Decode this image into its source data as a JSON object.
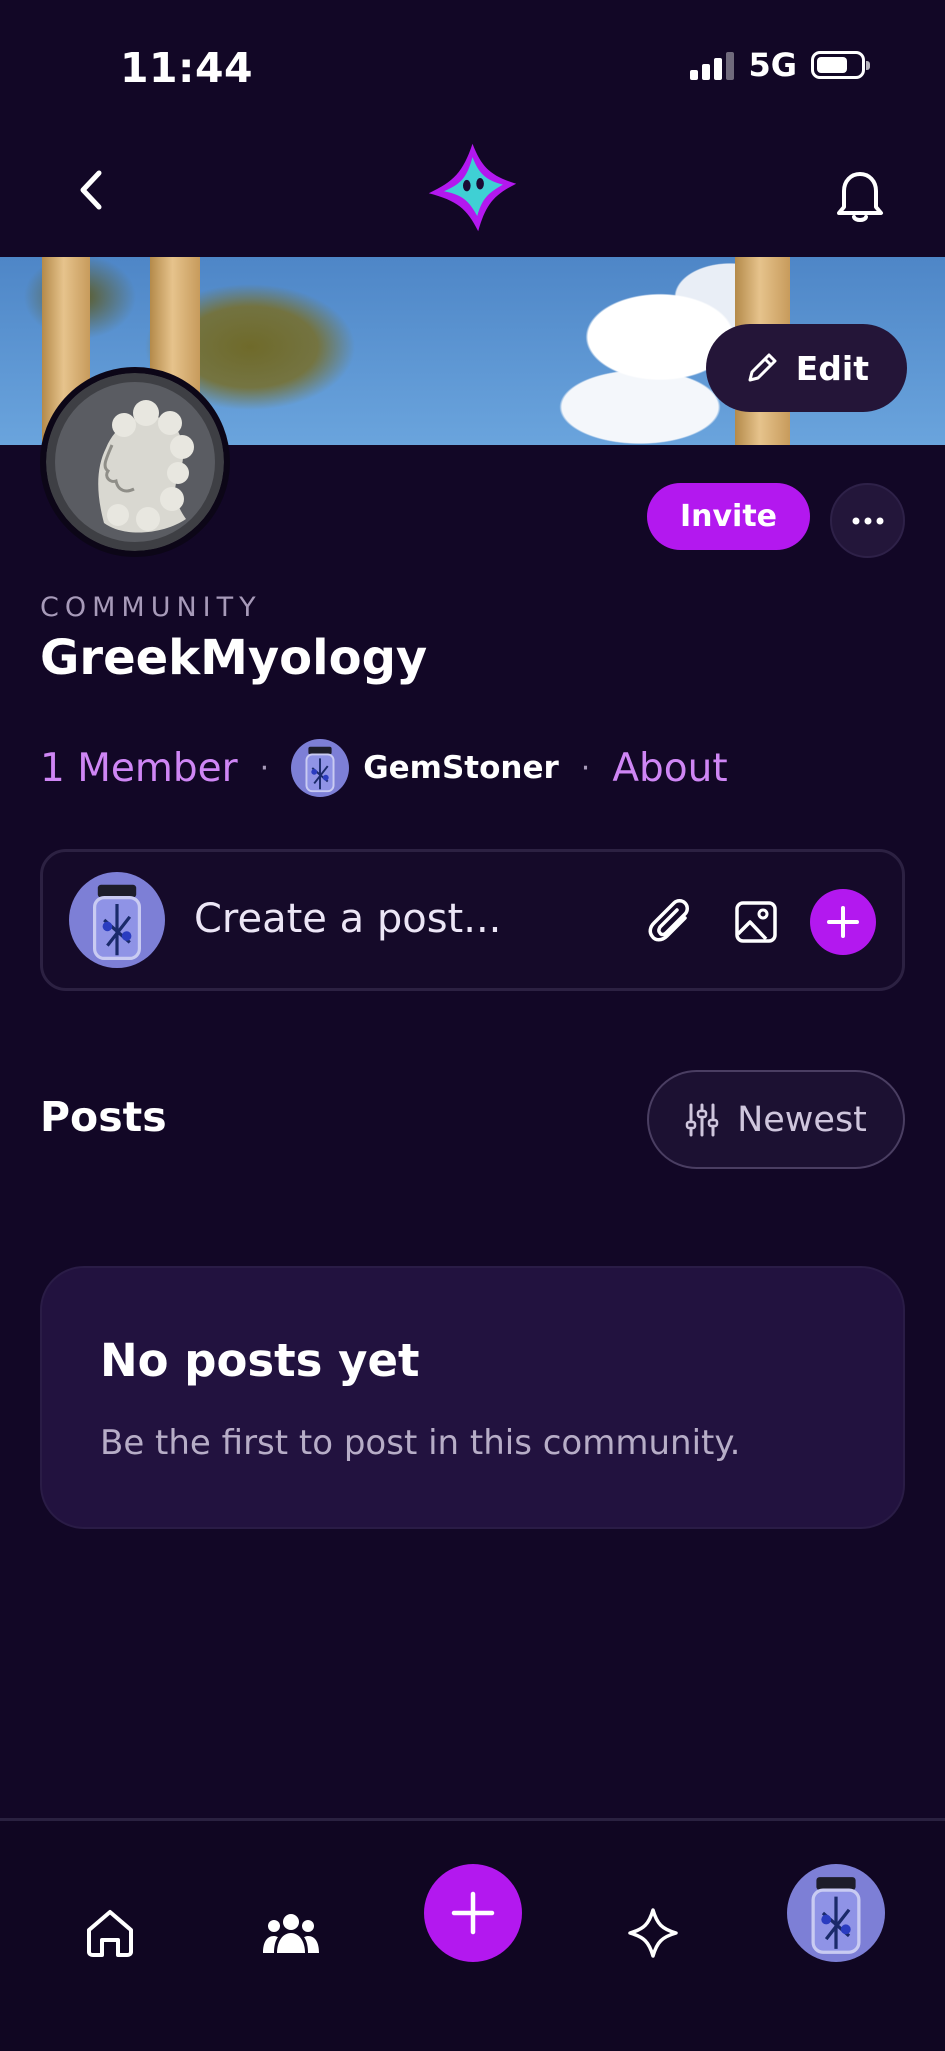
{
  "status_bar": {
    "time": "11:44",
    "network": "5G"
  },
  "banner": {
    "edit_label": "Edit"
  },
  "community": {
    "label": "COMMUNITY",
    "name": "GreekMyology",
    "member_count": "1 Member",
    "owner": "GemStoner",
    "about_label": "About"
  },
  "actions": {
    "invite_label": "Invite"
  },
  "composer": {
    "placeholder": "Create a post..."
  },
  "posts": {
    "heading": "Posts",
    "sort_label": "Newest"
  },
  "empty_state": {
    "title": "No posts yet",
    "subtitle": "Be the first to post in this community."
  },
  "colors": {
    "accent": "#b318ef",
    "link": "#cf86f5",
    "background": "#120726"
  },
  "icons": [
    "back-icon",
    "app-logo-icon",
    "bell-icon",
    "pencil-icon",
    "more-icon",
    "paperclip-icon",
    "image-icon",
    "plus-icon",
    "sliders-icon",
    "home-icon",
    "community-icon",
    "sparkle-icon"
  ]
}
